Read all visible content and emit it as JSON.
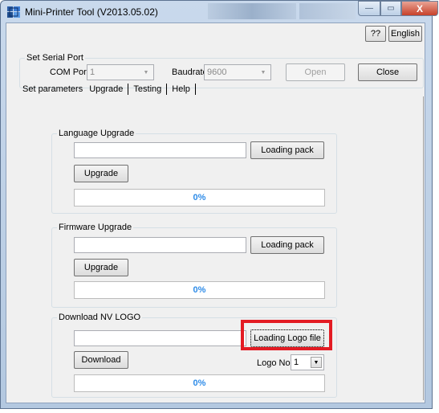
{
  "window": {
    "title": "Mini-Printer Tool (V2013.05.02)",
    "caption_buttons": {
      "minimize": "—",
      "maximize": "▭",
      "close": "X"
    }
  },
  "toolbar": {
    "help_label": "??",
    "language_label": "English"
  },
  "serial_port": {
    "group_label": "Set Serial Port",
    "com_port_label": "COM Port",
    "com_port_value": "1",
    "baudrate_label": "Baudrate",
    "baudrate_value": "9600",
    "open_label": "Open",
    "close_label": "Close"
  },
  "tabs": [
    {
      "label": "Set parameters"
    },
    {
      "label": "Upgrade"
    },
    {
      "label": "Testing"
    },
    {
      "label": "Help"
    }
  ],
  "language_upgrade": {
    "group_label": "Language Upgrade",
    "loading_label": "Loading pack",
    "upgrade_label": "Upgrade",
    "progress_text": "0%"
  },
  "firmware_upgrade": {
    "group_label": "Firmware Upgrade",
    "loading_label": "Loading pack",
    "upgrade_label": "Upgrade",
    "progress_text": "0%"
  },
  "nv_logo": {
    "group_label": "Download NV LOGO",
    "loading_label": "Loading Logo file",
    "download_label": "Download",
    "logo_no_label": "Logo No:",
    "logo_no_value": "1",
    "progress_text": "0%"
  },
  "colors": {
    "progress_text": "#2f8ce8",
    "highlight": "#e31b23"
  }
}
